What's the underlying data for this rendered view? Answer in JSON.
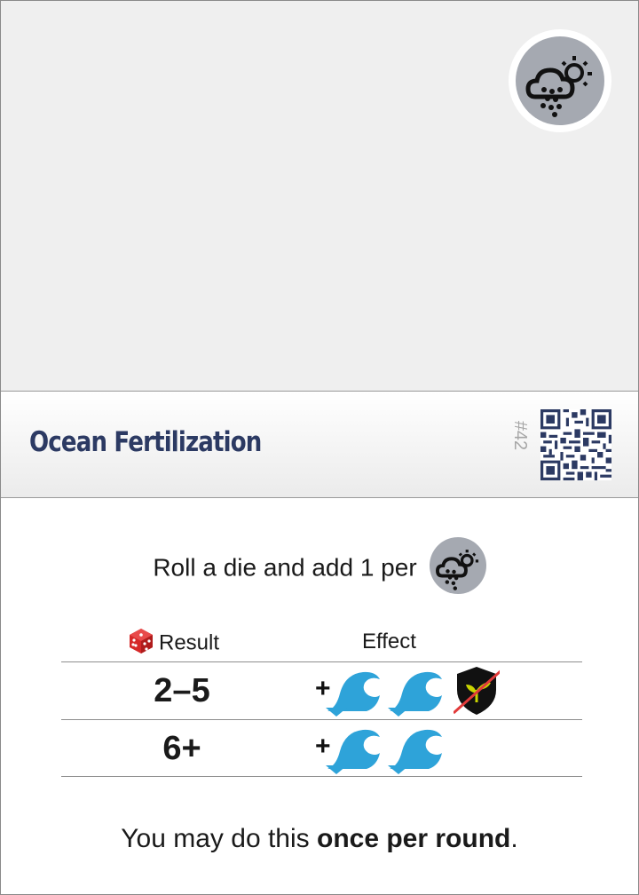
{
  "card": {
    "number": "#42",
    "title": "Ocean Fertilization",
    "category_icon": "cloud-rain-sun-icon",
    "instruction_text": "Roll a die and add 1 per",
    "instruction_icon": "cloud-rain-sun-icon",
    "table": {
      "result_header": "Result",
      "effect_header": "Effect",
      "result_icon": "red-die-icon",
      "rows": [
        {
          "result": "2–5",
          "plus": "+",
          "effects": [
            "ocean-wave-icon",
            "ocean-wave-icon",
            "crossed-out-plant-shield-icon"
          ]
        },
        {
          "result": "6+",
          "plus": "+",
          "effects": [
            "ocean-wave-icon",
            "ocean-wave-icon"
          ]
        }
      ]
    },
    "footer_prefix": "You may do this ",
    "footer_bold": "once per round",
    "footer_suffix": "."
  },
  "colors": {
    "title": "#2c3a63",
    "wave": "#2ea3d9",
    "badge": "#a5a9b1",
    "die": "#d62828"
  }
}
